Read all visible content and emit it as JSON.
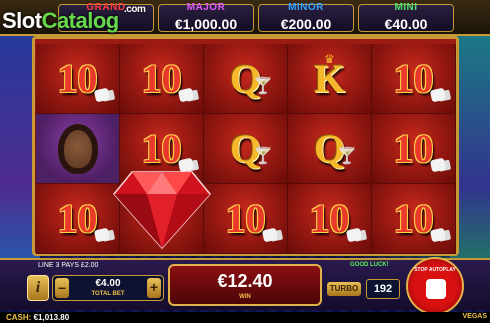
{
  "brand": {
    "name_part1": "Slot",
    "name_part2": "Catalog",
    "suffix": ".com"
  },
  "jackpots": [
    {
      "name": "GRAND",
      "value": ""
    },
    {
      "name": "MAJOR",
      "value": "€1,000.00"
    },
    {
      "name": "MINOR",
      "value": "€200.00"
    },
    {
      "name": "MINI",
      "value": "€40.00"
    }
  ],
  "reels": {
    "rows": [
      [
        "10",
        "10",
        "Q",
        "K",
        "10"
      ],
      [
        "portrait",
        "10",
        "Q",
        "Q",
        "10"
      ],
      [
        "10",
        "diamond",
        "10",
        "10",
        "10"
      ]
    ]
  },
  "controls": {
    "line_info": "LINE 3 PAYS £2.00",
    "good_luck": "GOOD LUCK!",
    "info_label": "i",
    "bet_minus": "–",
    "bet_plus": "+",
    "total_bet_value": "€4.00",
    "total_bet_label": "TOTAL BET",
    "win_value": "€12.40",
    "win_label": "WIN",
    "turbo_label": "TURBO",
    "autoplay_count": "192",
    "stop_autoplay_label": "STOP AUTOPLAY"
  },
  "status": {
    "cash_label": "CASH:",
    "cash_value": "€1,013.80",
    "game_name": "VEGAS"
  }
}
